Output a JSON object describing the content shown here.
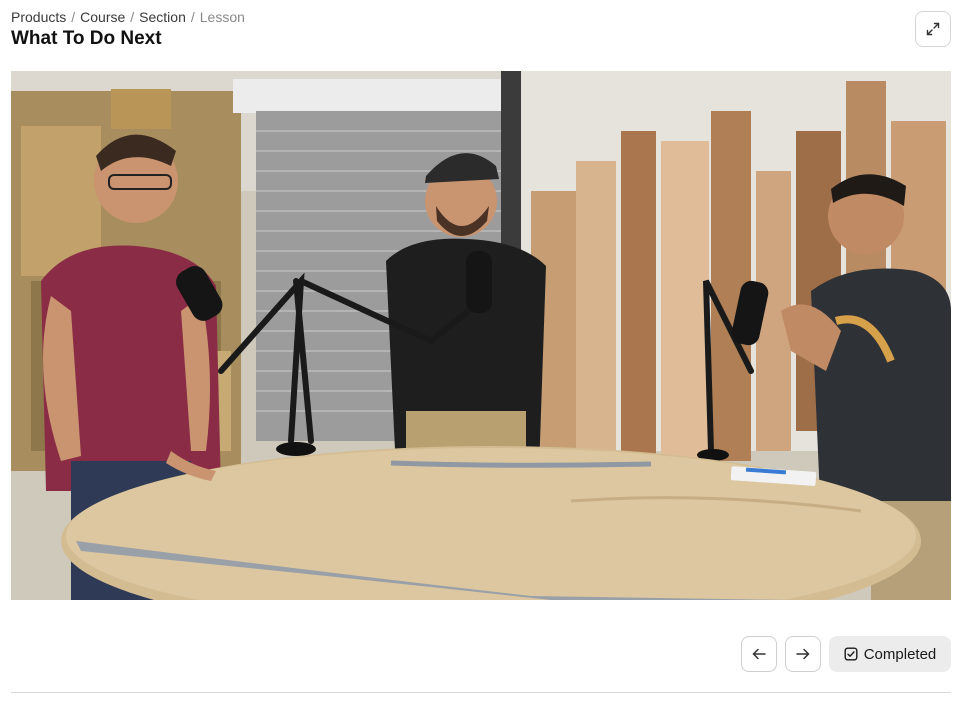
{
  "breadcrumb": {
    "items": [
      "Products",
      "Course",
      "Section"
    ],
    "separator": "/",
    "current": "Lesson"
  },
  "lesson": {
    "title": "What To Do Next"
  },
  "header": {
    "expand_icon": "expand-arrows-icon"
  },
  "video": {
    "description_icon": "video-frame"
  },
  "controls": {
    "prev_icon": "arrow-left-icon",
    "next_icon": "arrow-right-icon",
    "completed_label": "Completed",
    "completed_icon": "checkbox-checked-icon"
  },
  "colors": {
    "text_primary": "#111111",
    "text_muted": "#8a8a8a",
    "button_border": "#d5d5d5",
    "completed_bg": "#ececec"
  }
}
